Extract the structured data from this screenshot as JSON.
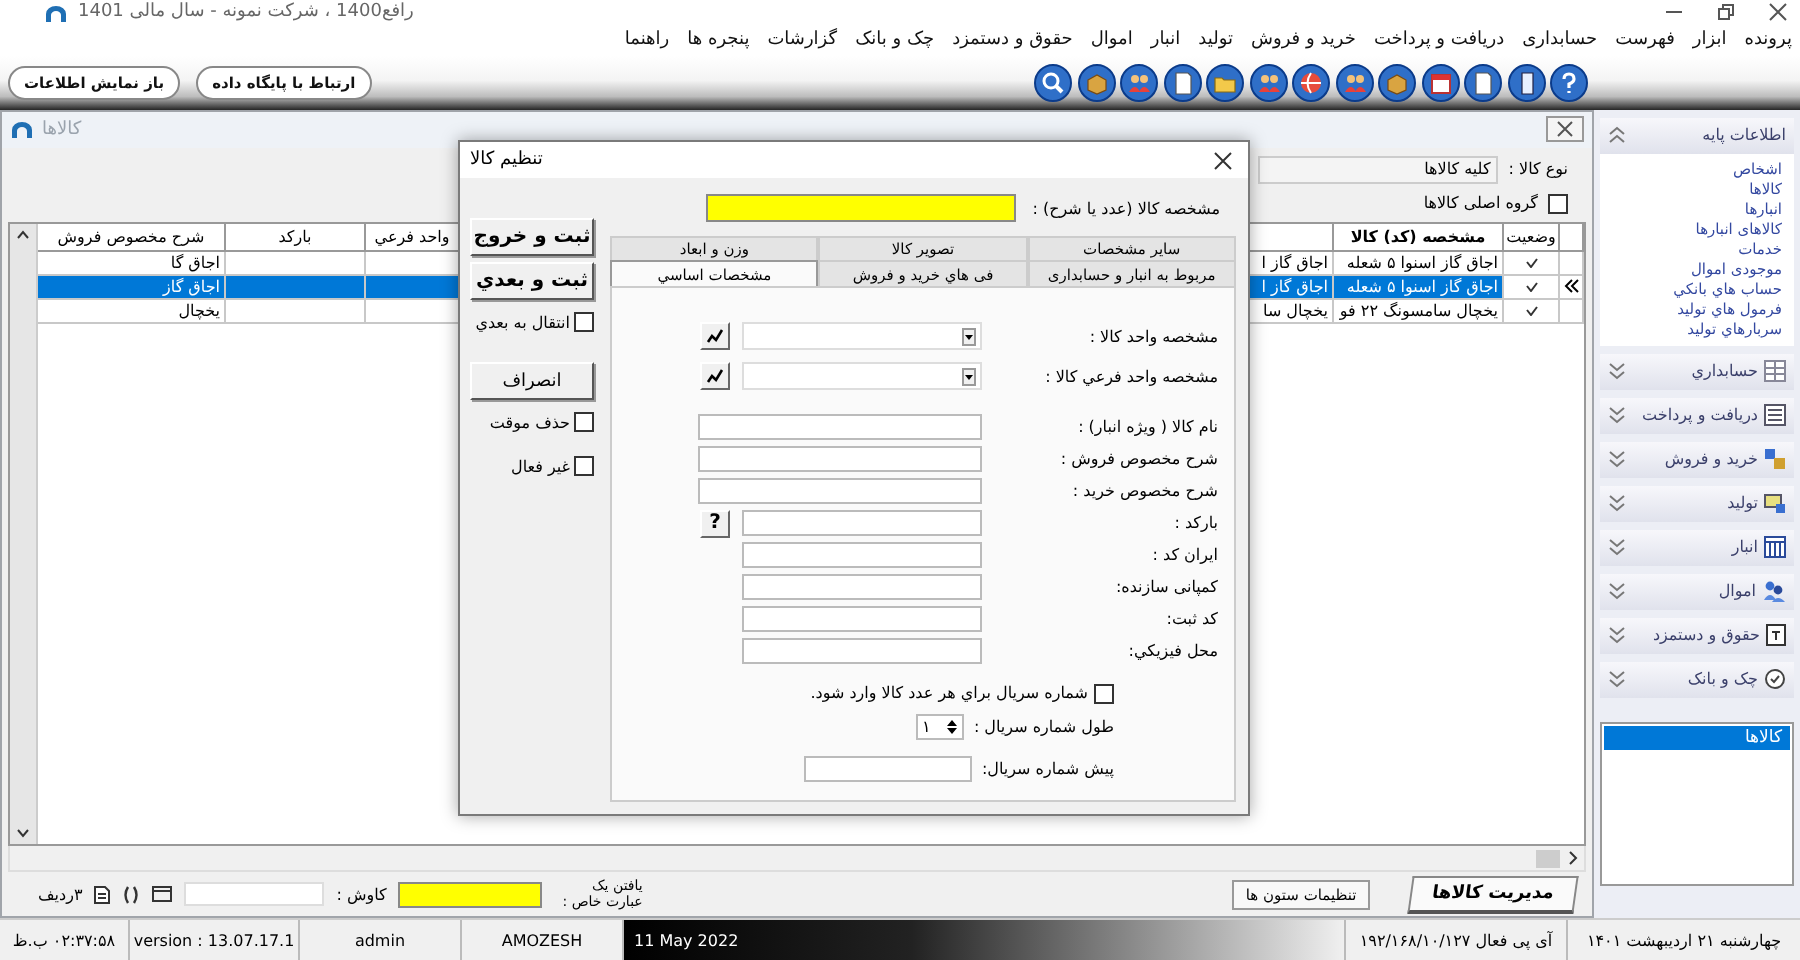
{
  "window": {
    "title": "رافع1400 ، شرکت نمونه - سال مالی 1401"
  },
  "menu": [
    "پرونده",
    "ابزار",
    "فهرست",
    "حسابداری",
    "دریافت و پرداخت",
    "خرید و فروش",
    "تولید",
    "انبار",
    "اموال",
    "حقوق و دستمزد",
    "چک و بانک",
    "گزارشات",
    "پنجره ها",
    "راهنما"
  ],
  "toolbar": {
    "buttons": [
      "ارتباط با پایگاه داده",
      "باز نمایش اطلاعات"
    ]
  },
  "goods_window": {
    "title": "کالاها",
    "type_label": "نوع کالا :",
    "type_value": "کلیه کالاها",
    "main_group": {
      "label": "گروه اصلی کالاها",
      "checked": false
    },
    "table": {
      "columns": [
        "وضعیت",
        "مشخصه (کد) کالا",
        "واحد فرعي",
        "بارکد",
        "شرح مخصوص فروش"
      ],
      "rows": [
        {
          "active": true,
          "selected": false,
          "code": "اجاق گاز اسنوا ۵ شعله",
          "column_4": "اجاق گاز ا",
          "sales_description": "اجاق گا"
        },
        {
          "active": true,
          "selected": true,
          "code": "اجاق گاز اسنوا ۵ شعله",
          "column_4": "اجاق گاز ا",
          "sales_description": "اجاق گاز"
        },
        {
          "active": true,
          "selected": false,
          "code": "یخچال سامسونگ ۲۲ فو",
          "column_4": "یخچال سا",
          "sales_description": "یخچال"
        }
      ]
    },
    "bottom": {
      "tab": "مدیریت کالاها",
      "columns_button": "تنظیمات ستون ها",
      "find_label": "یافتن یک عبارت خاص :",
      "search_label": "کاوش :",
      "row_count": "۳ردیف"
    }
  },
  "dialog": {
    "title": "تنظیم کالا",
    "id_label": "مشخصه کالا (عدد یا شرح) :",
    "actions": [
      {
        "kind": "primary",
        "label": "ثبت و خروج"
      },
      {
        "kind": "primary",
        "label": "ثبت و بعدي"
      },
      {
        "kind": "checkbox",
        "label": "انتقال به بعدي",
        "checked": false
      },
      {
        "kind": "button",
        "label": "انصراف"
      },
      {
        "kind": "checkbox",
        "label": "حذف موقت",
        "checked": false
      },
      {
        "kind": "checkbox",
        "label": "غیر فعال",
        "checked": false
      }
    ],
    "tabs_back": [
      {
        "label": "سایر مشخصات",
        "selected": false
      },
      {
        "label": "تصویر کالا",
        "selected": false
      },
      {
        "label": "وزن و ابعاد",
        "selected": false
      }
    ],
    "tabs_front": [
      {
        "label": "مربوط به انبار و حسابداری",
        "selected": false
      },
      {
        "label": "فی هاي خرید و فروش",
        "selected": false
      },
      {
        "label": "مشخصات اساسي",
        "selected": true
      }
    ],
    "fields": [
      {
        "kind": "dropdown",
        "label": "مشخصه واحد کالا :"
      },
      {
        "kind": "dropdown",
        "label": "مشخصه واحد فرعي کالا :"
      },
      {
        "kind": "wide",
        "label": "نام کالا ( ویژه انبار) :"
      },
      {
        "kind": "wide",
        "label": "شرح مخصوص فروش :"
      },
      {
        "kind": "wide",
        "label": "شرح مخصوص خرید :"
      },
      {
        "kind": "help",
        "label": "بارکد :",
        "button": "?"
      },
      {
        "kind": "text",
        "label": "ایران کد :"
      },
      {
        "kind": "text",
        "label": "کمپانی سازنده:"
      },
      {
        "kind": "text",
        "label": "کد ثبت:"
      },
      {
        "kind": "text",
        "label": "محل فیزیکي:"
      }
    ],
    "serial_checkbox": {
      "label": "شماره سریال براي هر عدد کالا وارد شود.",
      "checked": false
    },
    "serial_length": {
      "label": "طول شماره سریال :",
      "value": "۱"
    },
    "serial_prefix": {
      "label": "پیش شماره سریال:"
    }
  },
  "sidebar": {
    "groups": [
      {
        "title": "اطلاعات پایه",
        "expanded": true,
        "items": [
          "اشخاص",
          "کالاها",
          "انبارها",
          "کالاهای انبارها",
          "خدمات",
          "موجودی اموال",
          "حساب هاي بانکي",
          "فرمول هاي تولید",
          "سربارهاي تولید"
        ]
      },
      {
        "title": "حسابداري",
        "expanded": false
      },
      {
        "title": "دریافت و پرداخت",
        "expanded": false
      },
      {
        "title": "خرید و فروش",
        "expanded": false
      },
      {
        "title": "تولید",
        "expanded": false
      },
      {
        "title": "انبار",
        "expanded": false
      },
      {
        "title": "اموال",
        "expanded": false
      },
      {
        "title": "حقوق و دستمزد",
        "expanded": false
      },
      {
        "title": "چک و بانک",
        "expanded": false
      }
    ],
    "windows": [
      {
        "label": "کالاها",
        "selected": true
      }
    ]
  },
  "status_bar": {
    "date": "چهارشنبه ۲۱ اردیبهشت ۱۴۰۱",
    "ip": "آی پی فعال ۱۹۲/۱۶۸/۱۰/۱۲۷",
    "date_en": "11 May 2022",
    "database": "AMOZESH",
    "user": "admin",
    "version": "version : 13.07.17.1",
    "time": "۰۲:۳۷:۵۸ ب.ظ"
  }
}
